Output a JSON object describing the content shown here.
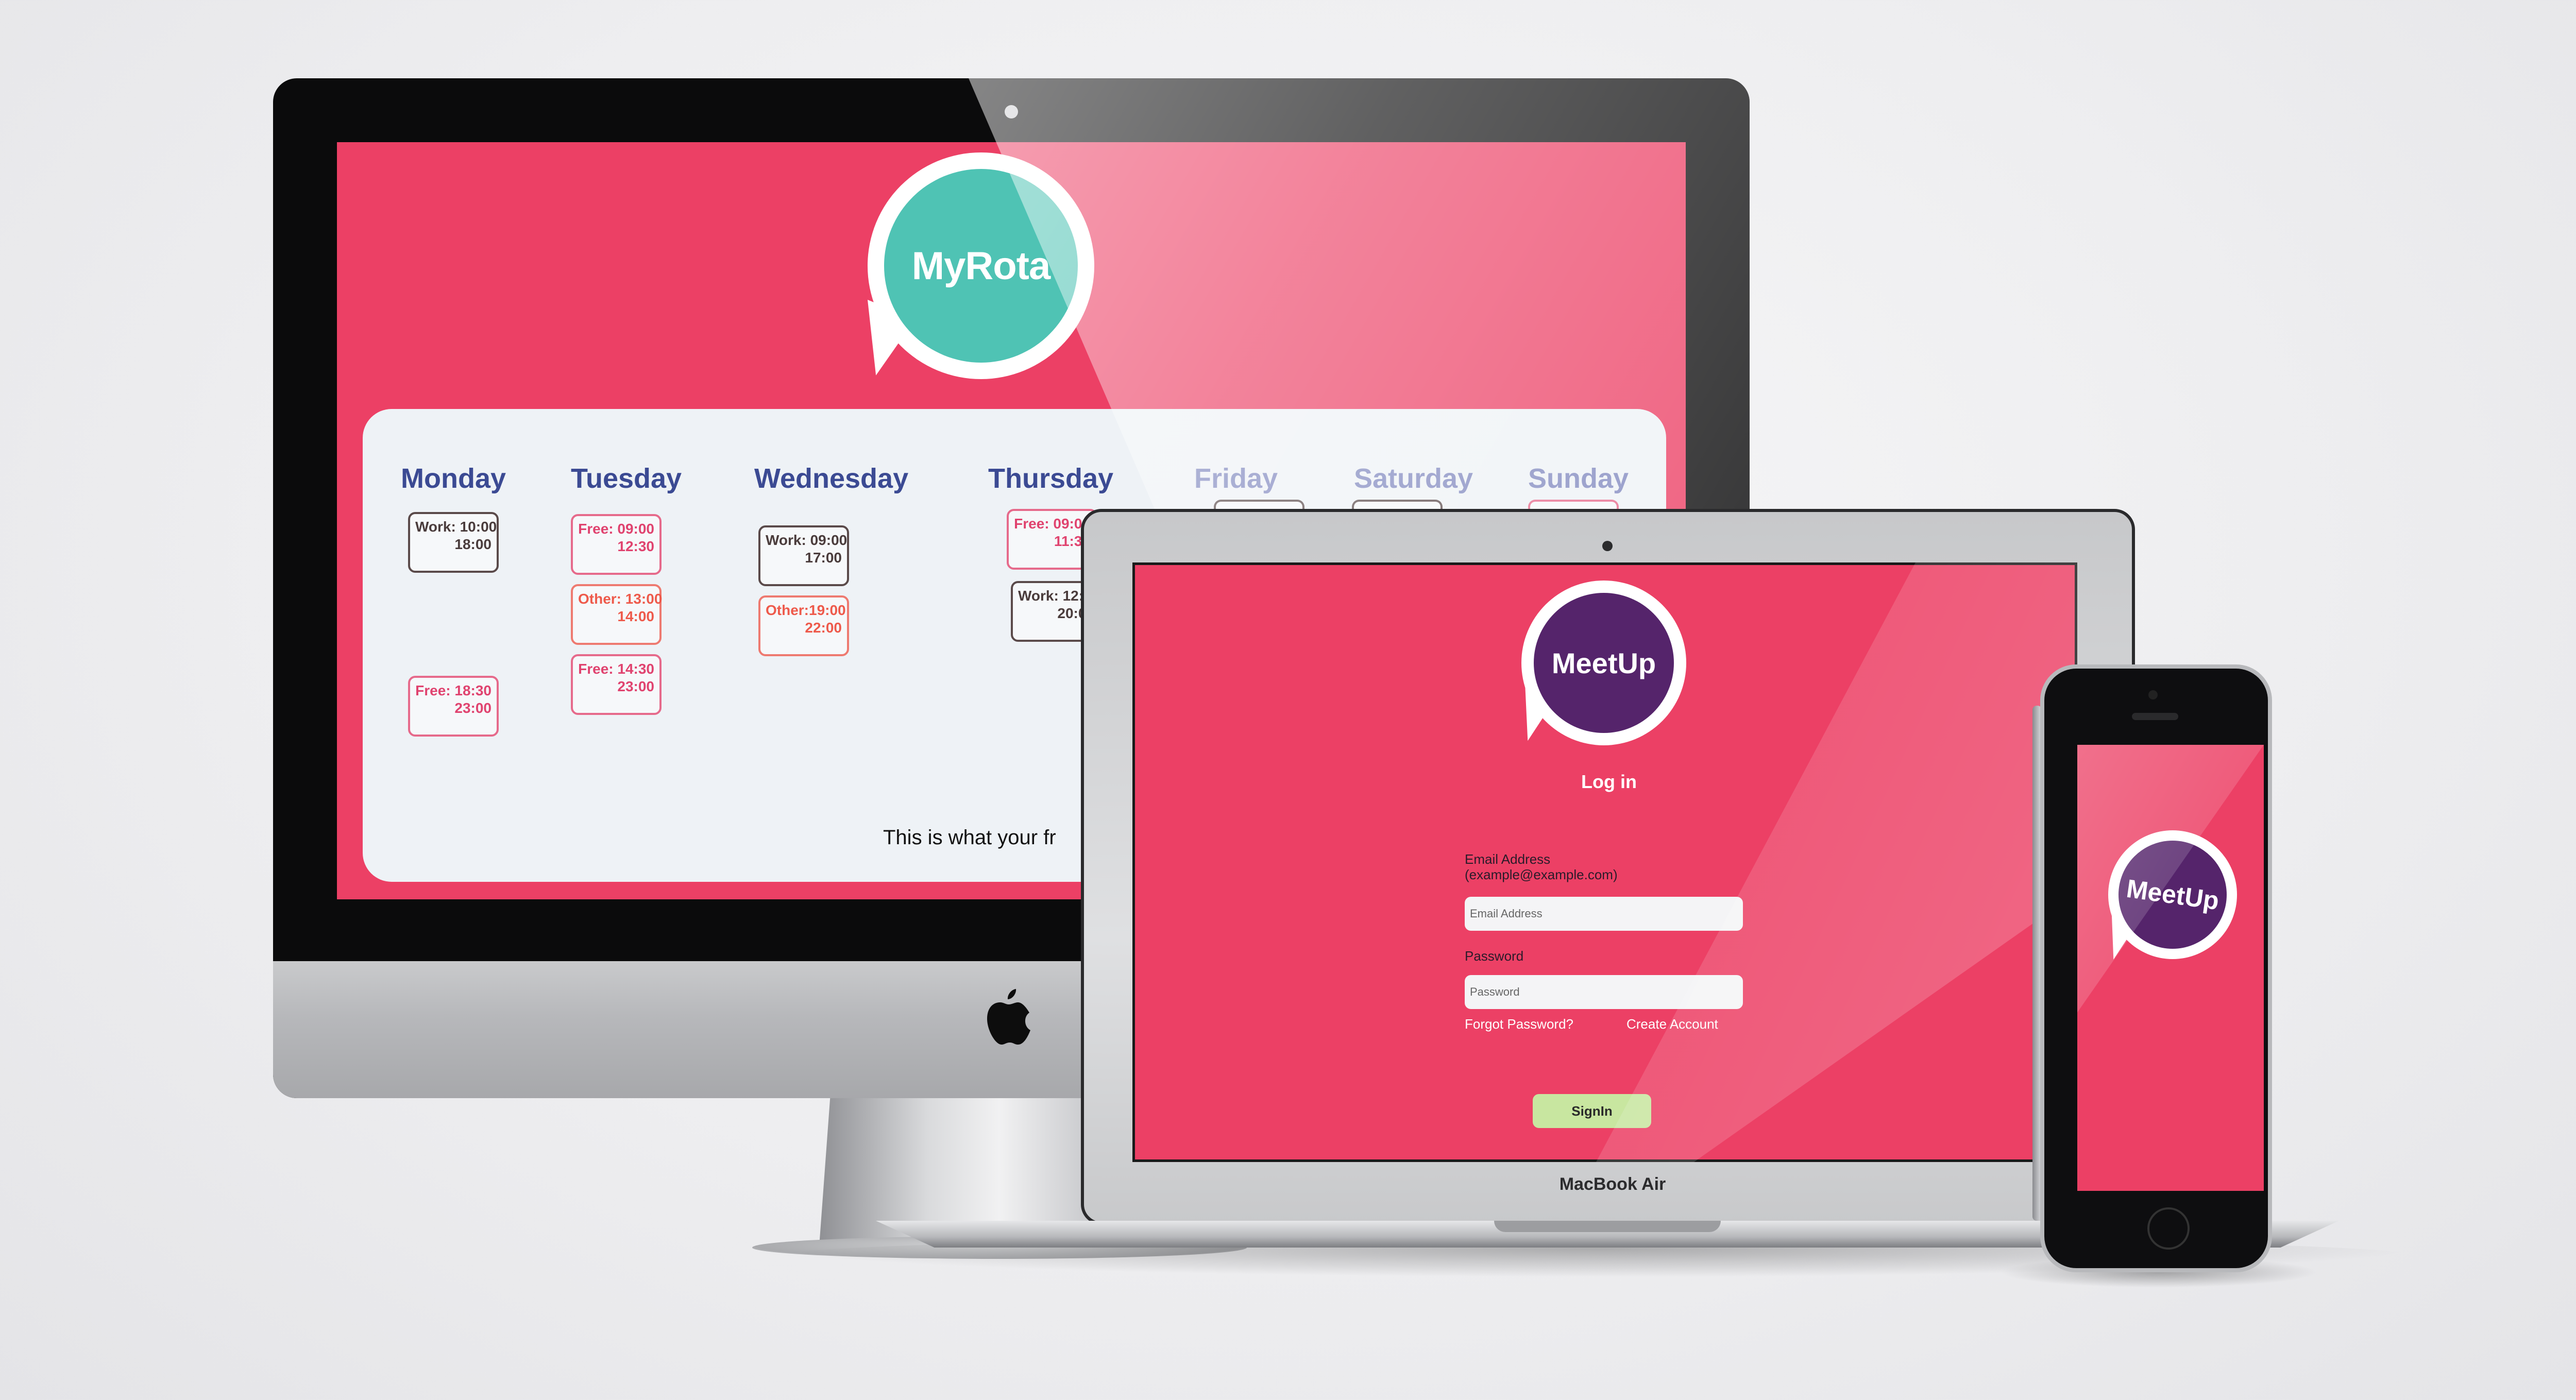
{
  "desktop_app": {
    "logo_text": "MyRota",
    "days": [
      "Monday",
      "Tuesday",
      "Wednesday",
      "Thursday",
      "Friday",
      "Saturday",
      "Sunday"
    ],
    "shifts": {
      "monday": [
        {
          "type": "Work:",
          "start": "10:00",
          "end": "18:00"
        },
        {
          "type": "Free:",
          "start": "18:30",
          "end": "23:00"
        }
      ],
      "tuesday": [
        {
          "type": "Free:",
          "start": "09:00",
          "end": "12:30"
        },
        {
          "type": "Other:",
          "start": "13:00",
          "end": "14:00"
        },
        {
          "type": "Free:",
          "start": "14:30",
          "end": "23:00"
        }
      ],
      "wednesday": [
        {
          "type": "Work:",
          "start": "09:00",
          "end": "17:00"
        },
        {
          "type": "Other:",
          "start": "19:00",
          "end": "22:00"
        }
      ],
      "thursday": [
        {
          "type": "Free:",
          "start": "09:00",
          "end": "11:30"
        },
        {
          "type": "Work:",
          "start": "12:00",
          "end": "20:00"
        }
      ]
    },
    "footer_text": "This is what your fr"
  },
  "laptop_app": {
    "logo_text": "MeetUp",
    "title": "Log in",
    "email_label_line1": "Email Address",
    "email_label_line2": "(example@example.com)",
    "email_placeholder": "Email Address",
    "password_label": "Password",
    "password_placeholder": "Password",
    "forgot_password": "Forgot Password?",
    "create_account": "Create Account",
    "signin_label": "SignIn",
    "device_brand": "MacBook Air"
  },
  "phone_app": {
    "logo_text": "MeetUp"
  },
  "colors": {
    "brand_pink": "#ec4065",
    "teal": "#4fc3b4",
    "purple": "#55246b",
    "day_heading": "#3b4a93",
    "signin_green": "#c8e6a0"
  },
  "icons": [
    "apple-icon"
  ]
}
